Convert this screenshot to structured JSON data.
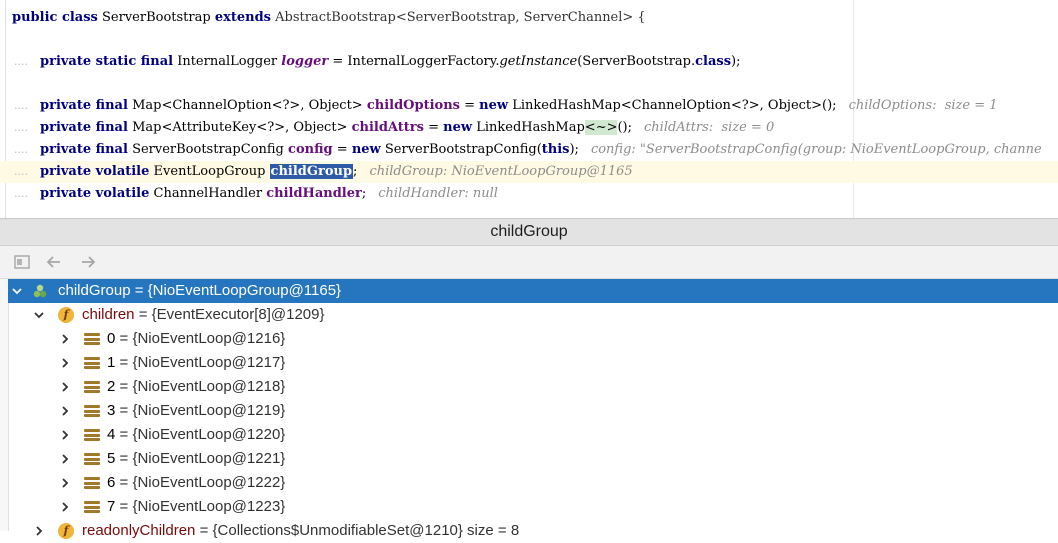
{
  "editor": {
    "class_line": {
      "kw1": "public class",
      "name": "ServerBootstrap",
      "kw2": "extends",
      "rest": "AbstractBootstrap<ServerBootstrap, ServerChannel> {"
    },
    "logger_line": {
      "dots": "....",
      "kw": "private static final",
      "type": "InternalLogger",
      "field": "logger",
      "eq": "= InternalLoggerFactory.",
      "method": "getInstance",
      "tail": "(ServerBootstrap.",
      "kwclass": "class",
      "end": ");"
    },
    "child_options_line": {
      "dots": "....",
      "kw": "private final",
      "type": "Map<ChannelOption<?>, Object>",
      "field": "childOptions",
      "eq": "=",
      "kwnew": "new",
      "init": "LinkedHashMap<ChannelOption<?>, Object>();",
      "hint": "childOptions:  size = 1"
    },
    "child_attrs_line": {
      "dots": "....",
      "kw": "private final",
      "type": "Map<AttributeKey<?>, Object>",
      "field": "childAttrs",
      "eq": "=",
      "kwnew": "new",
      "init_a": "LinkedHashMap",
      "init_b": "<~>",
      "init_c": "();",
      "hint": "childAttrs:  size = 0"
    },
    "config_line": {
      "dots": "....",
      "kw": "private final",
      "type": "ServerBootstrapConfig",
      "field": "config",
      "eq": "=",
      "kwnew": "new",
      "init": "ServerBootstrapConfig(",
      "kwthis": "this",
      "end": ");",
      "hint": "config: \"ServerBootstrapConfig(group: NioEventLoopGroup, channe"
    },
    "child_group_line": {
      "dots": "....",
      "kw": "private volatile",
      "type": "EventLoopGroup",
      "field": "childGroup",
      "end": ";",
      "hint": "childGroup: NioEventLoopGroup@1165"
    },
    "child_handler_line": {
      "dots": "....",
      "kw": "private volatile",
      "type": "ChannelHandler",
      "field": "childHandler",
      "end": ";",
      "hint": "childHandler: null"
    }
  },
  "debugger": {
    "title": "childGroup",
    "toolbar": {
      "restore_icon": "restore-layout-icon",
      "back_icon": "back-arrow-icon",
      "forward_icon": "forward-arrow-icon"
    },
    "root": {
      "name": "childGroup",
      "value": "= {NioEventLoopGroup@1165}"
    },
    "children_node": {
      "name": "children",
      "value": "= {EventExecutor[8]@1209}"
    },
    "items": [
      {
        "index": "0",
        "value": "= {NioEventLoop@1216}"
      },
      {
        "index": "1",
        "value": "= {NioEventLoop@1217}"
      },
      {
        "index": "2",
        "value": "= {NioEventLoop@1218}"
      },
      {
        "index": "3",
        "value": "= {NioEventLoop@1219}"
      },
      {
        "index": "4",
        "value": "= {NioEventLoop@1220}"
      },
      {
        "index": "5",
        "value": "= {NioEventLoop@1221}"
      },
      {
        "index": "6",
        "value": "= {NioEventLoop@1222}"
      },
      {
        "index": "7",
        "value": "= {NioEventLoop@1223}"
      }
    ],
    "next_node": {
      "name": "readonlyChildren",
      "value": "= {Collections$UnmodifiableSet@1210}  size = 8"
    }
  },
  "colors": {
    "keyword": "#000080",
    "field": "#660e7a",
    "selection": "#2675bf",
    "current_line": "#fffae3"
  }
}
